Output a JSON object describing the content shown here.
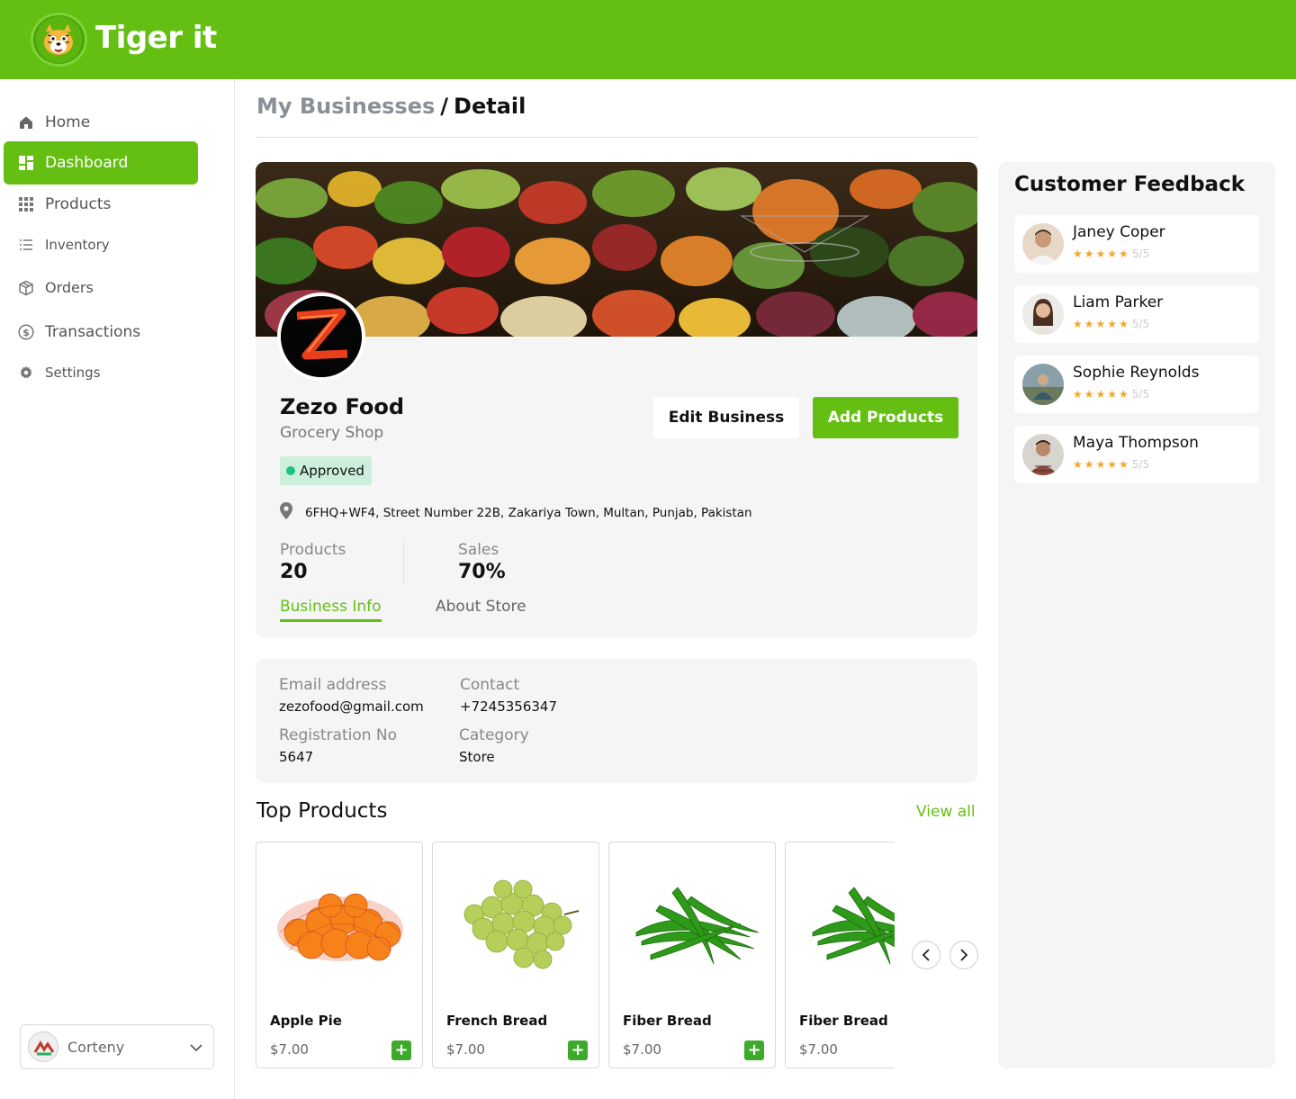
{
  "brand": {
    "name": "Tiger it",
    "primary_color": "#64bf12",
    "logo_icon": "tiger-mascot-icon"
  },
  "sidebar": {
    "items": [
      {
        "label": "Home",
        "icon": "home-icon",
        "active": false
      },
      {
        "label": "Dashboard",
        "icon": "dashboard-icon",
        "active": true
      },
      {
        "label": "Products",
        "icon": "grid-icon",
        "active": false
      },
      {
        "label": "Inventory",
        "icon": "list-icon",
        "active": false
      },
      {
        "label": "Orders",
        "icon": "box-icon",
        "active": false
      },
      {
        "label": "Transactions",
        "icon": "dollar-circle-icon",
        "active": false
      },
      {
        "label": "Settings",
        "icon": "gear-icon",
        "active": false
      }
    ],
    "user": {
      "name": "Corteny"
    }
  },
  "breadcrumb": {
    "parent": "My Businesses",
    "separator": "/",
    "current": "Detail"
  },
  "business": {
    "name": "Zezo Food",
    "type": "Grocery Shop",
    "status": "Approved",
    "address": "6FHQ+WF4, Street Number 22B, Zakariya Town, Multan, Punjab, Pakistan",
    "edit_label": "Edit Business",
    "add_label": "Add Products",
    "stats": {
      "products_label": "Products",
      "products_value": "20",
      "sales_label": "Sales",
      "sales_value": "70%"
    },
    "tabs": [
      {
        "label": "Business Info",
        "active": true
      },
      {
        "label": "About Store",
        "active": false
      }
    ]
  },
  "info": {
    "email_label": "Email address",
    "email_value": "zezofood@gmail.com",
    "contact_label": "Contact",
    "contact_value": "+7245356347",
    "reg_label": "Registration No",
    "reg_value": "5647",
    "category_label": "Category",
    "category_value": "Store"
  },
  "top_products": {
    "title": "Top Products",
    "view_all": "View all",
    "items": [
      {
        "name": "Apple Pie",
        "price": "$7.00",
        "image": "oranges-in-net"
      },
      {
        "name": "French Bread",
        "price": "$7.00",
        "image": "green-grapes"
      },
      {
        "name": "Fiber Bread",
        "price": "$7.00",
        "image": "green-chilies"
      },
      {
        "name": "Fiber Bread",
        "price": "$7.00",
        "image": "green-chilies"
      }
    ]
  },
  "feedback": {
    "title": "Customer Feedback",
    "items": [
      {
        "name": "Janey Coper",
        "stars": "★★★★★",
        "score": "5/5"
      },
      {
        "name": "Liam Parker",
        "stars": "★★★★★",
        "score": "5/5"
      },
      {
        "name": "Sophie Reynolds",
        "stars": "★★★★★",
        "score": "5/5"
      },
      {
        "name": "Maya Thompson",
        "stars": "★★★★★",
        "score": "5/5"
      }
    ]
  }
}
